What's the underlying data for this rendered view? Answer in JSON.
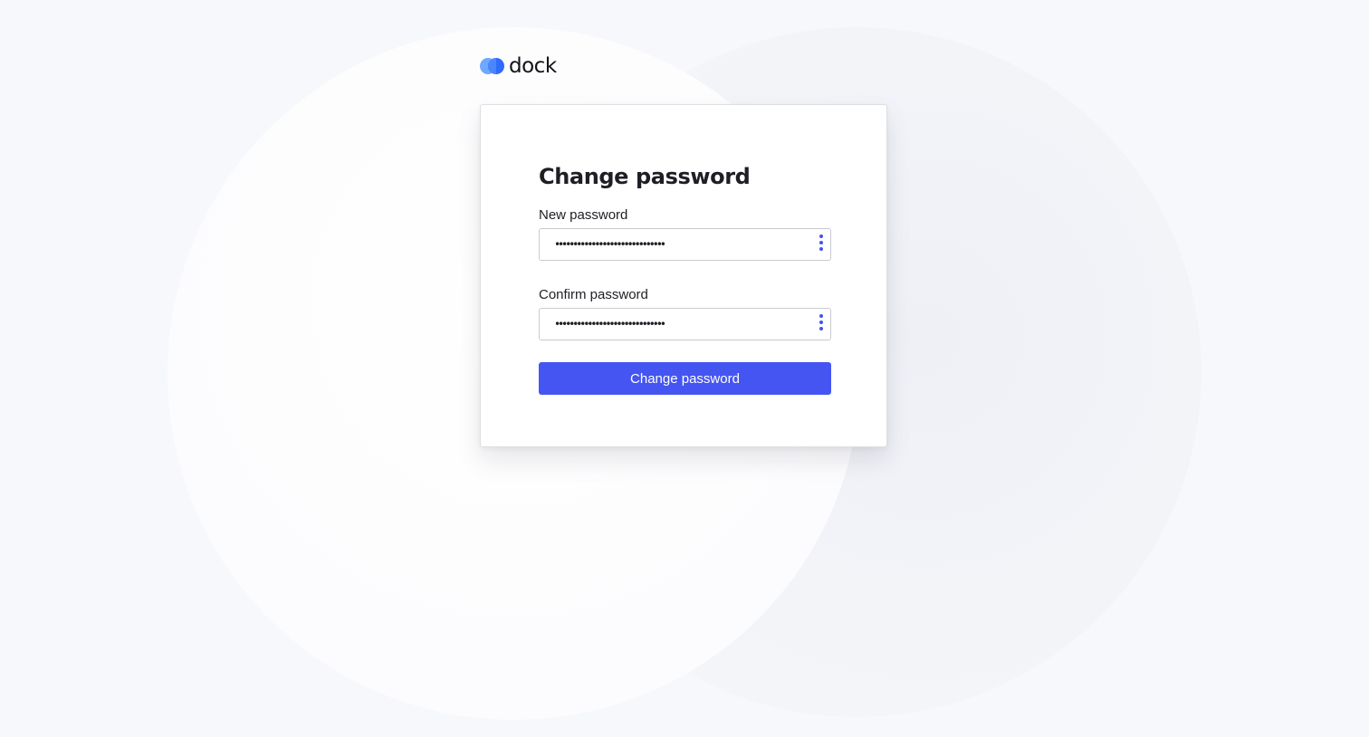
{
  "brand": {
    "name": "dock",
    "icon": "dock-logo-icon"
  },
  "form": {
    "title": "Change password",
    "new_password": {
      "label": "New password",
      "value": "••••••••••••••••••••••••••••••",
      "menu_icon": "kebab-menu-icon"
    },
    "confirm_password": {
      "label": "Confirm password",
      "value": "••••••••••••••••••••••••••••••",
      "menu_icon": "kebab-menu-icon"
    },
    "submit_label": "Change password"
  },
  "colors": {
    "accent": "#4555f2",
    "logo_light": "#6ea8ff",
    "logo_dark": "#2f6bff",
    "background": "#f7f8fb"
  }
}
